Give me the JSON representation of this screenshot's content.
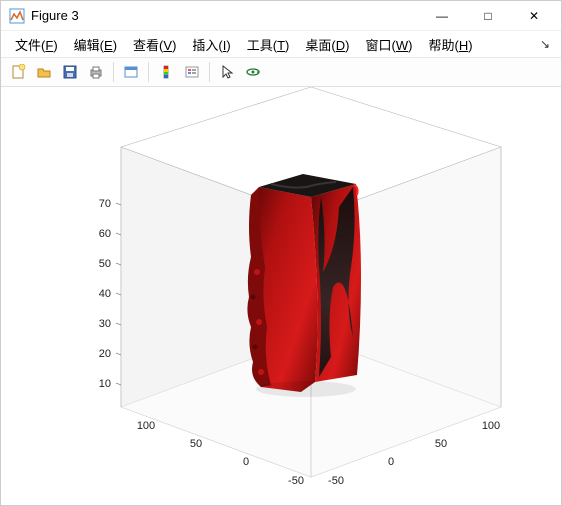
{
  "window": {
    "title": "Figure 3",
    "controls": {
      "minimize": "—",
      "maximize": "□",
      "close": "✕"
    }
  },
  "menu": {
    "file": {
      "label": "文件",
      "mnemonic": "F"
    },
    "edit": {
      "label": "编辑",
      "mnemonic": "E"
    },
    "view": {
      "label": "查看",
      "mnemonic": "V"
    },
    "insert": {
      "label": "插入",
      "mnemonic": "I"
    },
    "tools": {
      "label": "工具",
      "mnemonic": "T"
    },
    "desktop": {
      "label": "桌面",
      "mnemonic": "D"
    },
    "window": {
      "label": "窗口",
      "mnemonic": "W"
    },
    "help": {
      "label": "帮助",
      "mnemonic": "H"
    }
  },
  "toolbar": {
    "new": "new-figure-icon",
    "open": "open-icon",
    "save": "save-icon",
    "print": "print-icon",
    "datacursor": "data-cursor-icon",
    "colorbar": "colorbar-icon",
    "legend": "legend-icon",
    "pointer": "pointer-icon",
    "rotate3d": "rotate-3d-icon"
  },
  "chart_data": {
    "type": "3d_surface",
    "description": "Rendered 3D volume/surface of a tall roughly prism-shaped object with red and dark gray/black shading",
    "axes": {
      "x": {
        "ticks": [
          -50,
          0,
          50,
          100
        ]
      },
      "y": {
        "ticks": [
          -50,
          0,
          50,
          100
        ]
      },
      "z": {
        "ticks": [
          10,
          20,
          30,
          40,
          50,
          60,
          70
        ]
      }
    },
    "colors": {
      "primary": "#a80d0d",
      "shadow": "#1a1616"
    }
  }
}
